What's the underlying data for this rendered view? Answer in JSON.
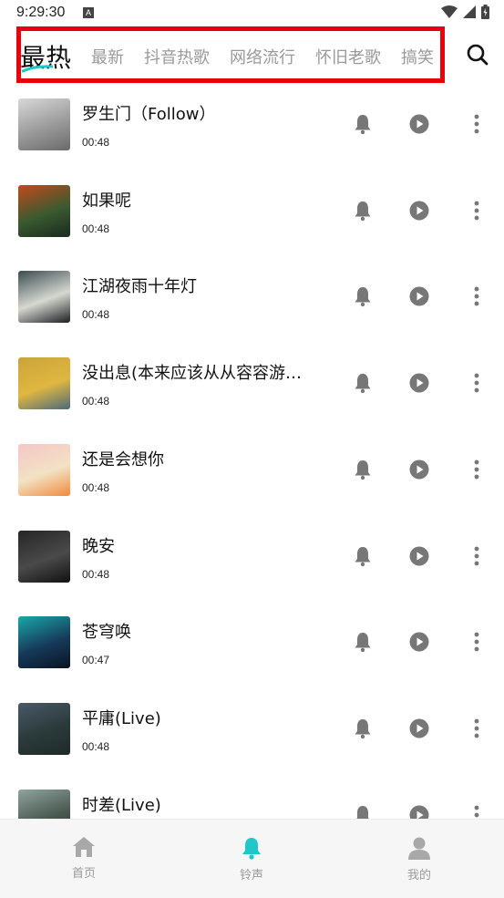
{
  "status_bar": {
    "time": "9:29:30",
    "notification_icon_letter": "A"
  },
  "tabs": [
    {
      "label": "最热",
      "active": true
    },
    {
      "label": "最新",
      "active": false
    },
    {
      "label": "抖音热歌",
      "active": false
    },
    {
      "label": "网络流行",
      "active": false
    },
    {
      "label": "怀旧老歌",
      "active": false
    },
    {
      "label": "搞笑",
      "active": false
    }
  ],
  "songs": [
    {
      "title": "罗生门（Follow）",
      "duration": "00:48"
    },
    {
      "title": "如果呢",
      "duration": "00:48"
    },
    {
      "title": "江湖夜雨十年灯",
      "duration": "00:48"
    },
    {
      "title": "没出息(本来应该从从容容游…",
      "duration": "00:48"
    },
    {
      "title": "还是会想你",
      "duration": "00:48"
    },
    {
      "title": "晚安",
      "duration": "00:48"
    },
    {
      "title": "苍穹唤",
      "duration": "00:47"
    },
    {
      "title": "平庸(Live)",
      "duration": "00:48"
    },
    {
      "title": "时差(Live)",
      "duration": ""
    }
  ],
  "bottom_nav": [
    {
      "label": "首页",
      "icon": "home-icon",
      "active": false
    },
    {
      "label": "铃声",
      "icon": "bell-icon",
      "active": true
    },
    {
      "label": "我的",
      "icon": "user-icon",
      "active": false
    }
  ],
  "colors": {
    "accent": "#1ec8c8",
    "highlight_box": "#e8000d",
    "icon_gray": "#777777",
    "text_muted": "#9a9a9a"
  }
}
